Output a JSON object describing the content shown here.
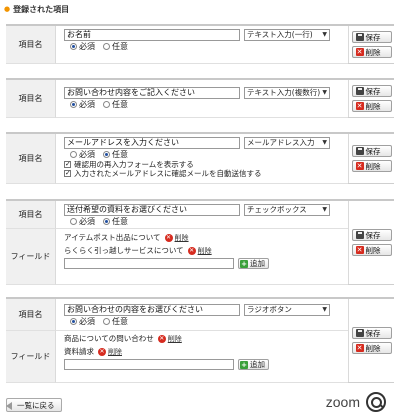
{
  "section_title": "登録された項目",
  "labels": {
    "item_name": "項目名",
    "field": "フィールド",
    "required": "必須",
    "optional": "任意",
    "save": "保存",
    "delete": "削除",
    "delete_link": "削除",
    "add": "追加"
  },
  "items": [
    {
      "name": "お名前",
      "type": "テキスト入力(一行)",
      "required": true
    },
    {
      "name": "お問い合わせ内容をご記入ください",
      "type": "テキスト入力(複数行)",
      "required": true
    },
    {
      "name": "メールアドレスを入力ください",
      "type": "メールアドレス入力",
      "required": false,
      "checkboxes": [
        {
          "label": "確認用の再入力フォームを表示する",
          "checked": true
        },
        {
          "label": "入力されたメールアドレスに確認メールを自動送信する",
          "checked": true
        }
      ]
    },
    {
      "name": "送付希望の資料をお選びください",
      "type": "チェックボックス",
      "required": false,
      "fields": [
        "アイテムポスト出品について",
        "らくらく引っ越しサービスについて"
      ]
    },
    {
      "name": "お問い合わせの内容をお選びください",
      "type": "ラジオボタン",
      "required": true,
      "fields": [
        "商品についての問い合わせ",
        "資料請求"
      ]
    }
  ],
  "footer": {
    "back_label": "一覧に戻る",
    "zoom_label": "zoom"
  }
}
